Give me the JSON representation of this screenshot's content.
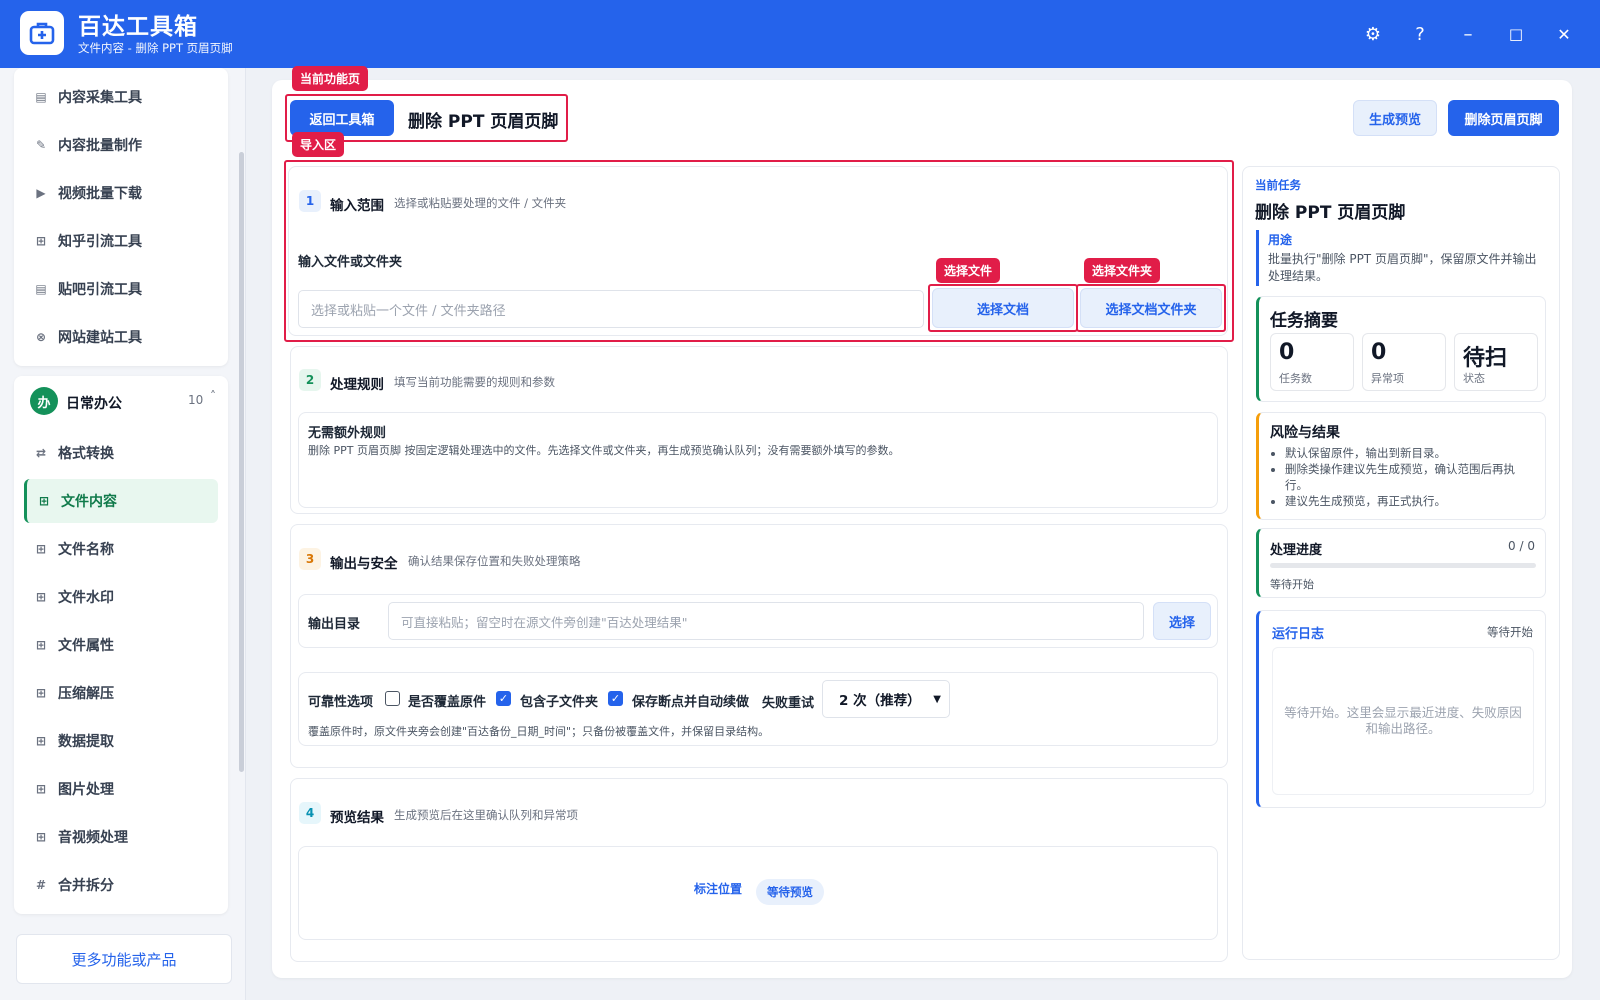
{
  "app": {
    "title": "百达工具箱",
    "subtitle": "文件内容 - 删除 PPT 页眉页脚"
  },
  "window": {
    "settings": "⚙",
    "help": "?",
    "minimize": "–",
    "maximize": "□",
    "close": "✕"
  },
  "sidebar": {
    "top_items": [
      {
        "icon": "▤",
        "label": "内容采集工具"
      },
      {
        "icon": "✎",
        "label": "内容批量制作"
      },
      {
        "icon": "▶",
        "label": "视频批量下载"
      },
      {
        "icon": "⊞",
        "label": "知乎引流工具"
      },
      {
        "icon": "▤",
        "label": "贴吧引流工具"
      },
      {
        "icon": "⊗",
        "label": "网站建站工具"
      }
    ],
    "group": {
      "badge": "办",
      "name": "日常办公",
      "count": "10",
      "chevron": "˄"
    },
    "group_items": [
      {
        "icon": "⇄",
        "label": "格式转换"
      },
      {
        "icon": "⊞",
        "label": "文件内容"
      },
      {
        "icon": "⊞",
        "label": "文件名称"
      },
      {
        "icon": "⊞",
        "label": "文件水印"
      },
      {
        "icon": "⊞",
        "label": "文件属性"
      },
      {
        "icon": "⊞",
        "label": "压缩解压"
      },
      {
        "icon": "⊞",
        "label": "数据提取"
      },
      {
        "icon": "⊞",
        "label": "图片处理"
      },
      {
        "icon": "⊞",
        "label": "音视频处理"
      },
      {
        "icon": "#",
        "label": "合并拆分"
      }
    ],
    "more": "更多功能或产品"
  },
  "header": {
    "tag_current": "当前功能页",
    "back": "返回工具箱",
    "title": "删除 PPT 页眉页脚",
    "preview": "生成预览",
    "run": "删除页眉页脚",
    "tag_import": "导入区"
  },
  "section1": {
    "num": "1",
    "title": "输入范围",
    "desc": "选择或粘贴要处理的文件 / 文件夹",
    "field_label": "输入文件或文件夹",
    "placeholder": "选择或粘贴一个文件 / 文件夹路径",
    "tag_file": "选择文件",
    "btn_file": "选择文档",
    "tag_folder": "选择文件夹",
    "btn_folder": "选择文档文件夹"
  },
  "section2": {
    "num": "2",
    "title": "处理规则",
    "desc": "填写当前功能需要的规则和参数",
    "rule_title": "无需额外规则",
    "rule_desc": "删除 PPT 页眉页脚 按固定逻辑处理选中的文件。先选择文件或文件夹，再生成预览确认队列；没有需要额外填写的参数。"
  },
  "section3": {
    "num": "3",
    "title": "输出与安全",
    "desc": "确认结果保存位置和失败处理策略",
    "out_label": "输出目录",
    "out_placeholder": "可直接粘贴；留空时在源文件旁创建\"百达处理结果\"",
    "out_btn": "选择",
    "opt_label": "可靠性选项",
    "opt_overwrite": "是否覆盖原件",
    "opt_subfolder": "包含子文件夹",
    "opt_resume": "保存断点并自动续做",
    "retry_label": "失败重试",
    "retry_value": "2 次（推荐）",
    "opt_note": "覆盖原件时，原文件夹旁会创建\"百达备份_日期_时间\"；只备份被覆盖文件，并保留目录结构。"
  },
  "section4": {
    "num": "4",
    "title": "预览结果",
    "desc": "生成预览后在这里确认队列和异常项",
    "mark": "标注位置",
    "status": "等待预览"
  },
  "right": {
    "task_label": "当前任务",
    "task_title": "删除 PPT 页眉页脚",
    "usage_label": "用途",
    "usage_text": "批量执行\"删除 PPT 页眉页脚\"，保留原文件并输出处理结果。",
    "summary_title": "任务摘要",
    "stats": [
      {
        "value": "0",
        "key": "任务数"
      },
      {
        "value": "0",
        "key": "异常项"
      },
      {
        "value": "待扫",
        "key": "状态"
      }
    ],
    "risk_title": "风险与结果",
    "risks": [
      "默认保留原件，输出到新目录。",
      "删除类操作建议先生成预览，确认范围后再执行。",
      "建议先生成预览，再正式执行。"
    ],
    "progress_title": "处理进度",
    "progress_count": "0 / 0",
    "progress_fraction": 0,
    "progress_status": "等待开始",
    "log_title": "运行日志",
    "log_status": "等待开始",
    "log_text": "等待开始。这里会显示最近进度、失败原因和输出路径。"
  },
  "colors": {
    "primary": "#2563eb",
    "annotation": "#e11d48",
    "active_green": "#14915a",
    "risk_orange": "#f59e0b"
  }
}
